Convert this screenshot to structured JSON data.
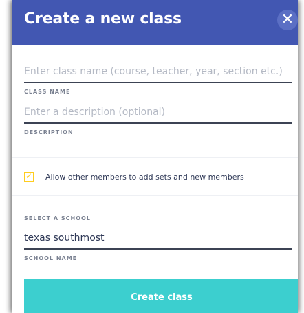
{
  "modal": {
    "title": "Create a new class",
    "close_glyph": "✕"
  },
  "fields": {
    "class_name": {
      "value": "",
      "placeholder": "Enter class name (course, teacher, year, section etc.)",
      "label": "CLASS NAME"
    },
    "description": {
      "value": "",
      "placeholder": "Enter a description (optional)",
      "label": "DESCRIPTION"
    },
    "school_name": {
      "value": "texas southmost",
      "label": "SCHOOL NAME"
    }
  },
  "permissions": {
    "checked": true,
    "check_glyph": "✓",
    "label": "Allow other members to add sets and new members"
  },
  "school_section": {
    "label": "SELECT A SCHOOL"
  },
  "actions": {
    "create_label": "Create class"
  },
  "colors": {
    "header": "#4257b2",
    "accent_checkbox": "#ffcd1f",
    "button": "#3ccfcf"
  }
}
